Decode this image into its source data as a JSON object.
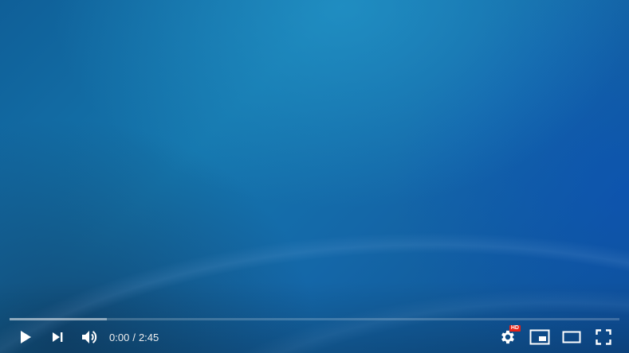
{
  "player": {
    "current_time": "0:00",
    "time_separator": "/",
    "duration": "2:45",
    "played_fraction": 0.0,
    "buffered_fraction": 0.16,
    "quality_badge": "HD",
    "colors": {
      "progress_played": "#ff0000",
      "progress_loaded": "rgba(255,255,255,0.42)",
      "hd_badge": "#e62117",
      "icon": "#ffffff"
    },
    "icons": {
      "play": "play-icon",
      "next": "next-icon",
      "volume": "volume-icon",
      "settings": "gear-icon",
      "miniplayer": "miniplayer-icon",
      "theater": "theater-mode-icon",
      "fullscreen": "fullscreen-icon"
    }
  }
}
